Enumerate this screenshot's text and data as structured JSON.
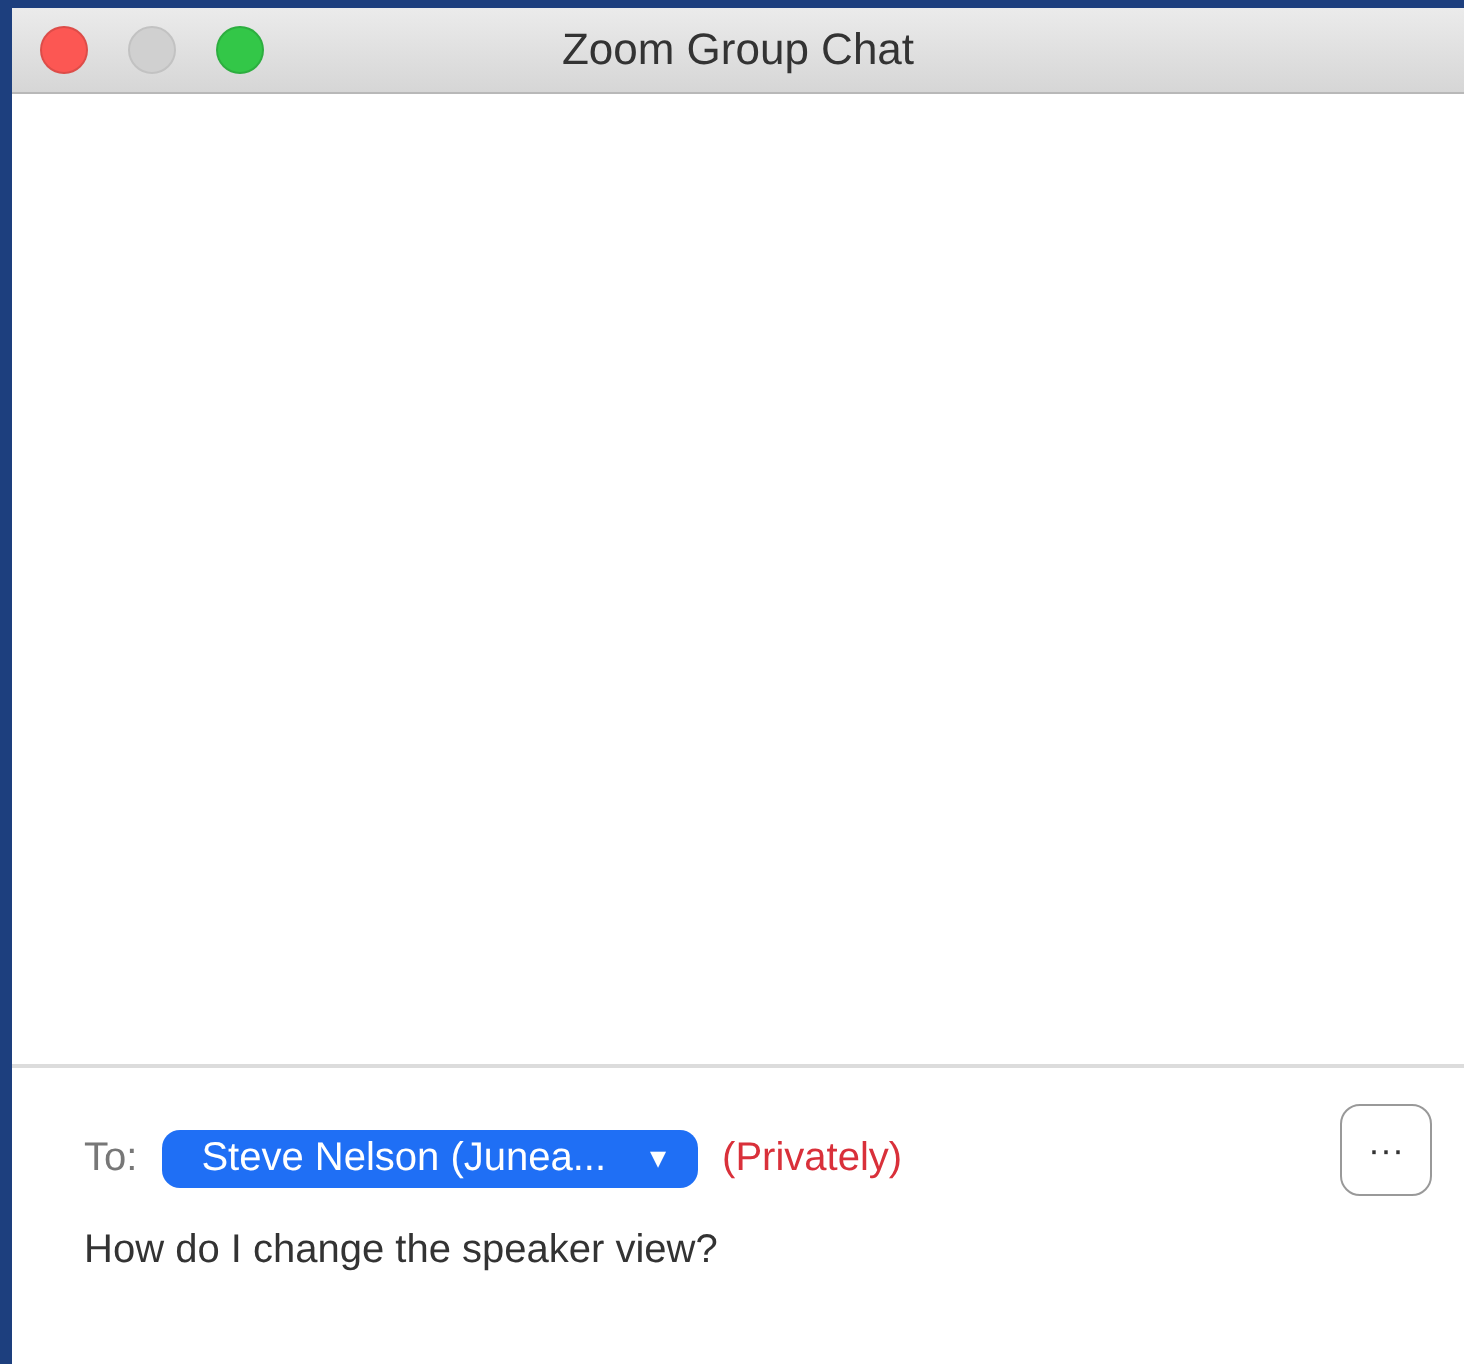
{
  "window": {
    "title": "Zoom Group Chat",
    "controls": [
      {
        "kind": "close",
        "disabled": false
      },
      {
        "kind": "minimize",
        "disabled": true
      },
      {
        "kind": "zoom",
        "disabled": false
      }
    ]
  },
  "composer": {
    "to_label": "To:",
    "recipient": "Steve Nelson (Junea...",
    "dropdown_icon": "▾",
    "privacy": "(Privately)",
    "more_button": "···",
    "message": {
      "value": "How do I change the speaker view?"
    }
  }
}
